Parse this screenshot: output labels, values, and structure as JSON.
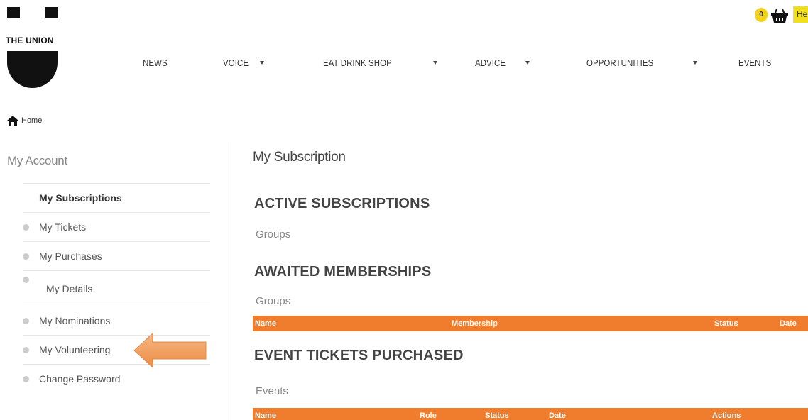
{
  "brand": {
    "logo_text": "THE UNION"
  },
  "header": {
    "cart_count": "0",
    "help_label": "He"
  },
  "nav": {
    "items": [
      {
        "label": "NEWS",
        "has_dropdown": false
      },
      {
        "label": "VOICE",
        "has_dropdown": true
      },
      {
        "label": "EAT DRINK SHOP",
        "has_dropdown": true
      },
      {
        "label": "ADVICE",
        "has_dropdown": true
      },
      {
        "label": "OPPORTUNITIES",
        "has_dropdown": true
      },
      {
        "label": "EVENTS",
        "has_dropdown": false
      }
    ]
  },
  "breadcrumb": {
    "home_label": "Home"
  },
  "sidebar": {
    "title": "My Account",
    "items": [
      {
        "label": "My Subscriptions",
        "active": true
      },
      {
        "label": "My Tickets",
        "active": false
      },
      {
        "label": "My Purchases",
        "active": false
      },
      {
        "label": "My Details",
        "active": false
      },
      {
        "label": "My Nominations",
        "active": false
      },
      {
        "label": "My Volunteering",
        "active": false
      },
      {
        "label": "Change Password",
        "active": false
      }
    ]
  },
  "main": {
    "title": "My Subscription",
    "active_subscriptions": {
      "heading": "ACTIVE SUBSCRIPTIONS",
      "group_label": "Groups"
    },
    "awaited_memberships": {
      "heading": "AWAITED MEMBERSHIPS",
      "group_label": "Groups",
      "columns": [
        "Name",
        "Membership",
        "Status",
        "Date"
      ]
    },
    "event_tickets": {
      "heading": "EVENT TICKETS PURCHASED",
      "group_label": "Events",
      "columns": [
        "Name",
        "Role",
        "Status",
        "Date",
        "Actions"
      ]
    }
  },
  "colors": {
    "accent_orange": "#ef7d2d",
    "badge_yellow": "#f3d21c",
    "arrow_orange": "#f0a05a"
  }
}
